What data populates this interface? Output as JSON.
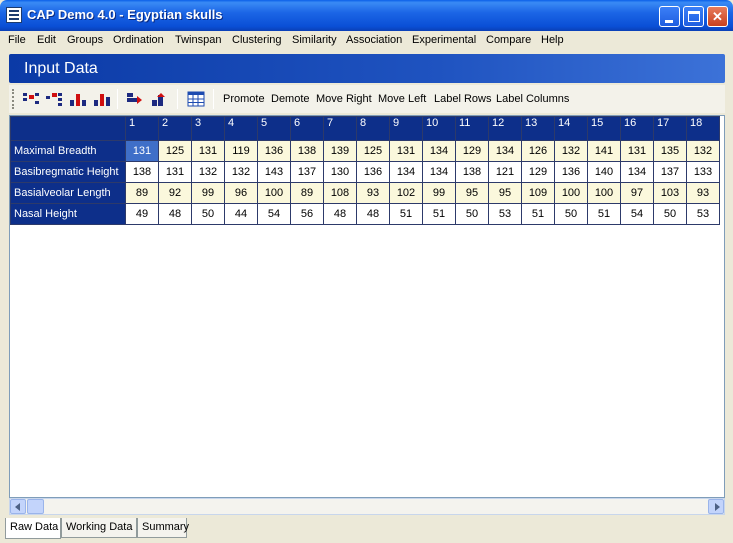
{
  "window": {
    "title": "CAP Demo 4.0 - Egyptian skulls",
    "min_label": "",
    "max_label": "",
    "close_label": "✕"
  },
  "menu": [
    "File",
    "Edit",
    "Groups",
    "Ordination",
    "Twinspan",
    "Clustering",
    "Similarity",
    "Association",
    "Experimental",
    "Compare",
    "Help"
  ],
  "panel": {
    "title": "Input Data"
  },
  "toolbar": {
    "icons": [
      "promote-rows-icon",
      "demote-rows-icon",
      "move-down-icon",
      "move-up-icon",
      "move-right-icon",
      "move-left-icon",
      "grid-icon"
    ],
    "buttons": [
      "Promote",
      "Demote",
      "Move Right",
      "Move Left",
      "Label Rows",
      "Label Columns"
    ]
  },
  "grid": {
    "columns": [
      "1",
      "2",
      "3",
      "4",
      "5",
      "6",
      "7",
      "8",
      "9",
      "10",
      "11",
      "12",
      "13",
      "14",
      "15",
      "16",
      "17",
      "18"
    ],
    "rows": [
      {
        "label": "Maximal Breadth",
        "values": [
          "131",
          "125",
          "131",
          "119",
          "136",
          "138",
          "139",
          "125",
          "131",
          "134",
          "129",
          "134",
          "126",
          "132",
          "141",
          "131",
          "135",
          "132"
        ]
      },
      {
        "label": "Basibregmatic Height",
        "values": [
          "138",
          "131",
          "132",
          "132",
          "143",
          "137",
          "130",
          "136",
          "134",
          "134",
          "138",
          "121",
          "129",
          "136",
          "140",
          "134",
          "137",
          "133"
        ]
      },
      {
        "label": "Basialveolar Length",
        "values": [
          "89",
          "92",
          "99",
          "96",
          "100",
          "89",
          "108",
          "93",
          "102",
          "99",
          "95",
          "95",
          "109",
          "100",
          "100",
          "97",
          "103",
          "93"
        ]
      },
      {
        "label": "Nasal Height",
        "values": [
          "49",
          "48",
          "50",
          "44",
          "54",
          "56",
          "48",
          "48",
          "51",
          "51",
          "50",
          "53",
          "51",
          "50",
          "51",
          "54",
          "50",
          "53"
        ]
      }
    ],
    "selected_cell": {
      "row": 0,
      "col": 0
    }
  },
  "tabs": [
    {
      "label": "Raw Data",
      "active": true
    },
    {
      "label": "Working Data",
      "active": false
    },
    {
      "label": "Summary",
      "active": false
    }
  ],
  "colors": {
    "header_blue": "#0d2f8a",
    "selected_cell": "#3f6fc8",
    "row_tint": "#fbf8dc"
  }
}
